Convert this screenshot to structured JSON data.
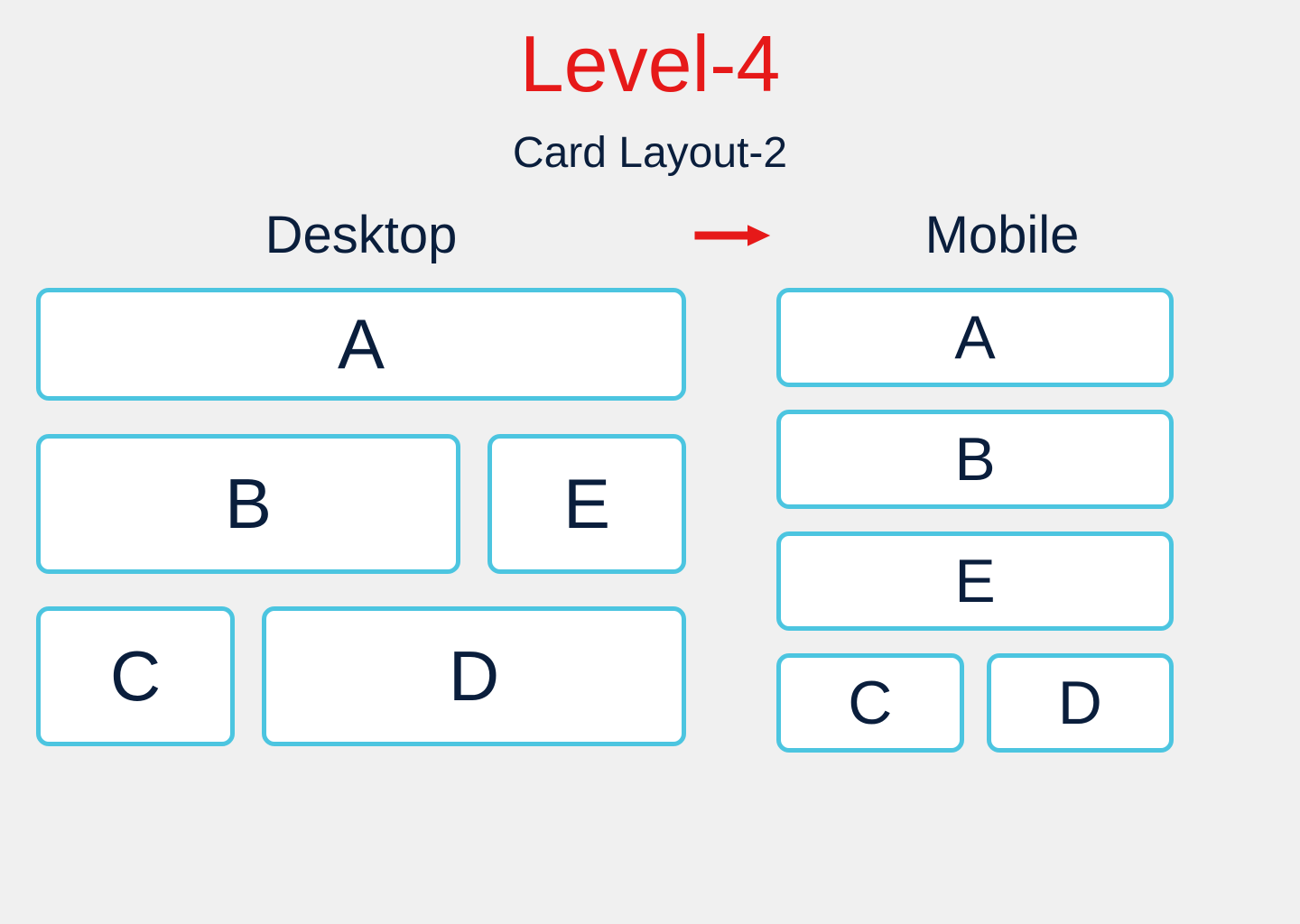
{
  "title": "Level-4",
  "subtitle": "Card Layout-2",
  "desktop_label": "Desktop",
  "mobile_label": "Mobile",
  "desktop_cards": {
    "a": "A",
    "b": "B",
    "e": "E",
    "c": "C",
    "d": "D"
  },
  "mobile_cards": {
    "a": "A",
    "b": "B",
    "e": "E",
    "c": "C",
    "d": "D"
  }
}
